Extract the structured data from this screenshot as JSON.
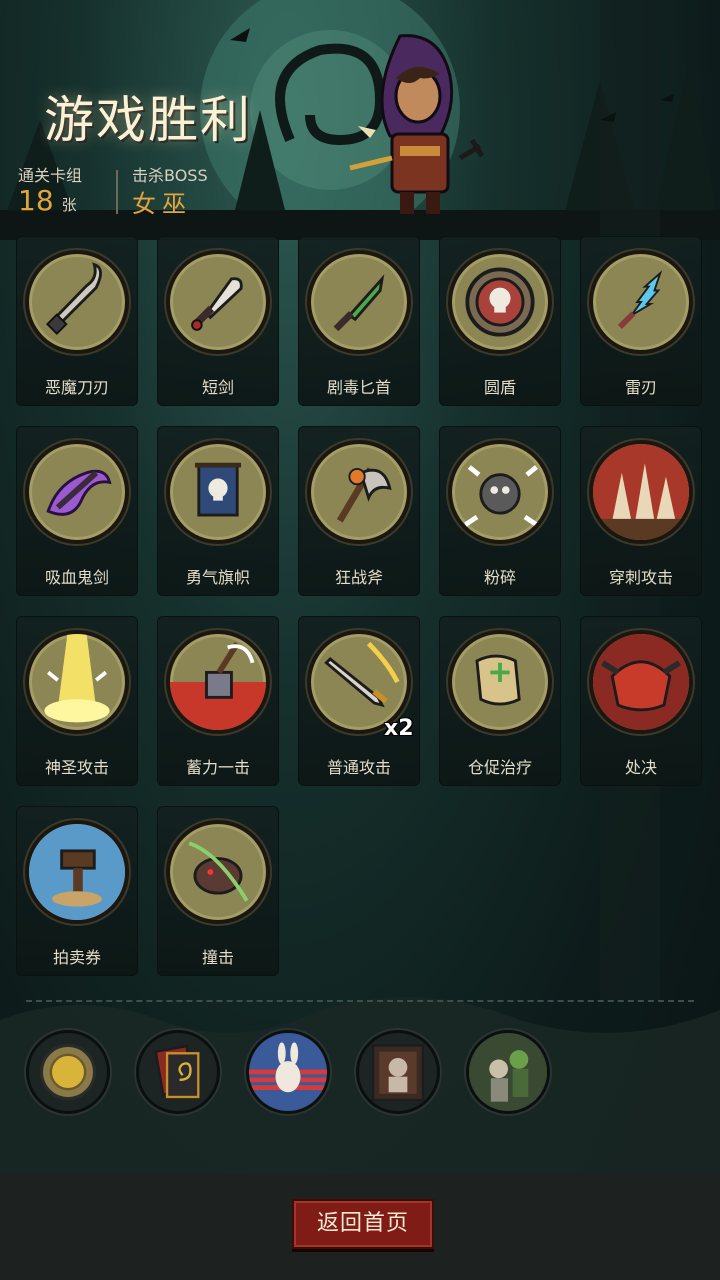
{
  "header": {
    "title": "游戏胜利",
    "deck_label": "通关卡组",
    "deck_count": "18",
    "deck_unit": "张",
    "boss_label": "击杀BOSS",
    "boss_name": "女巫"
  },
  "cards": [
    {
      "label": "恶魔刀刃",
      "icon": "demon-blade-icon"
    },
    {
      "label": "短剑",
      "icon": "short-sword-icon"
    },
    {
      "label": "剧毒匕首",
      "icon": "poison-dagger-icon"
    },
    {
      "label": "圆盾",
      "icon": "round-shield-icon"
    },
    {
      "label": "雷刃",
      "icon": "thunder-blade-icon"
    },
    {
      "label": "吸血鬼剑",
      "icon": "vampire-sword-icon"
    },
    {
      "label": "勇气旗帜",
      "icon": "courage-banner-icon"
    },
    {
      "label": "狂战斧",
      "icon": "berserker-axe-icon"
    },
    {
      "label": "粉碎",
      "icon": "smash-icon"
    },
    {
      "label": "穿刺攻击",
      "icon": "pierce-attack-icon"
    },
    {
      "label": "神圣攻击",
      "icon": "holy-attack-icon"
    },
    {
      "label": "蓄力一击",
      "icon": "charged-strike-icon"
    },
    {
      "label": "普通攻击",
      "icon": "normal-attack-icon",
      "badge": "x2"
    },
    {
      "label": "仓促治疗",
      "icon": "hasty-heal-icon"
    },
    {
      "label": "处决",
      "icon": "execute-icon"
    },
    {
      "label": "拍卖券",
      "icon": "auction-ticket-icon"
    },
    {
      "label": "撞击",
      "icon": "ram-strike-icon"
    }
  ],
  "relics": [
    {
      "icon": "gold-coin-relic-icon"
    },
    {
      "icon": "spiral-card-relic-icon"
    },
    {
      "icon": "rabbit-relic-icon"
    },
    {
      "icon": "portrait-relic-icon"
    },
    {
      "icon": "zombie-relic-icon"
    }
  ],
  "footer": {
    "home_button": "返回首页"
  },
  "colors": {
    "accent_gold": "#e3a43c",
    "button_red": "#7e1c15",
    "medal_bg": "#8c8655"
  }
}
